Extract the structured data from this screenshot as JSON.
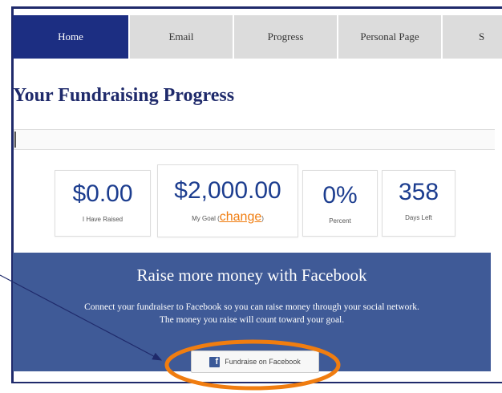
{
  "tabs": [
    {
      "label": "Home",
      "active": true
    },
    {
      "label": "Email",
      "active": false
    },
    {
      "label": "Progress",
      "active": false
    },
    {
      "label": "Personal Page",
      "active": false
    },
    {
      "label": "S",
      "active": false
    }
  ],
  "page_title": "Your Fundraising Progress",
  "progress_percent": 0,
  "stats": {
    "raised": {
      "value": "$0.00",
      "label": "I Have Raised"
    },
    "goal": {
      "value": "$2,000.00",
      "label_prefix": "My Goal (",
      "change_link": "change",
      "label_suffix": ")"
    },
    "percent": {
      "value": "0%",
      "label": "Percent"
    },
    "days": {
      "value": "358",
      "label": "Days Left"
    }
  },
  "facebook": {
    "heading": "Raise more money with Facebook",
    "description_line1": "Connect your fundraiser to Facebook so you can raise money through your social network.",
    "description_line2": "The money you raise will count toward your goal.",
    "button_label": "Fundraise on Facebook",
    "icon": "facebook-icon"
  },
  "annotations": {
    "arrow_color": "#1f2a6b",
    "highlight_color": "#f07d10"
  },
  "colors": {
    "tab_active": "#1c2e82",
    "tab_inactive": "#dcdcdc",
    "title": "#1f2a6b",
    "stat_value": "#1c3d8f",
    "panel": "#3f5a97"
  }
}
